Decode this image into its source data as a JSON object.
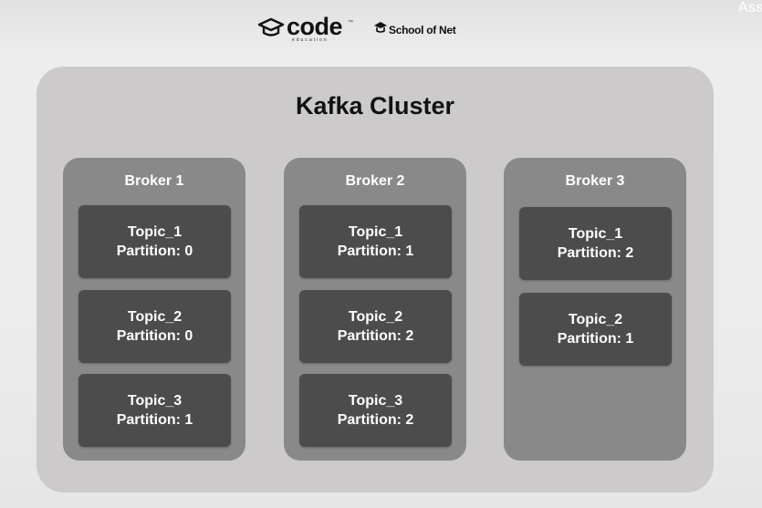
{
  "header": {
    "corner_text": "Ass",
    "logo_code": {
      "word": "code",
      "sub": "education",
      "tm": "™"
    },
    "logo_school": {
      "text": "School of Net"
    }
  },
  "cluster": {
    "title": "Kafka Cluster",
    "brokers": [
      {
        "name": "Broker 1",
        "partitions": [
          {
            "topic": "Topic_1",
            "partition": "Partition: 0"
          },
          {
            "topic": "Topic_2",
            "partition": "Partition: 0"
          },
          {
            "topic": "Topic_3",
            "partition": "Partition: 1"
          }
        ]
      },
      {
        "name": "Broker 2",
        "partitions": [
          {
            "topic": "Topic_1",
            "partition": "Partition: 1"
          },
          {
            "topic": "Topic_2",
            "partition": "Partition: 2"
          },
          {
            "topic": "Topic_3",
            "partition": "Partition: 2"
          }
        ]
      },
      {
        "name": "Broker 3",
        "partitions": [
          {
            "topic": "Topic_1",
            "partition": "Partition: 2"
          },
          {
            "topic": "Topic_2",
            "partition": "Partition: 1"
          }
        ]
      }
    ]
  },
  "colors": {
    "background": "#ececec",
    "cluster": "#cdcacb",
    "broker": "#898989",
    "partition": "#4c4c4c",
    "title_text": "#121212",
    "box_text": "#ffffff"
  }
}
